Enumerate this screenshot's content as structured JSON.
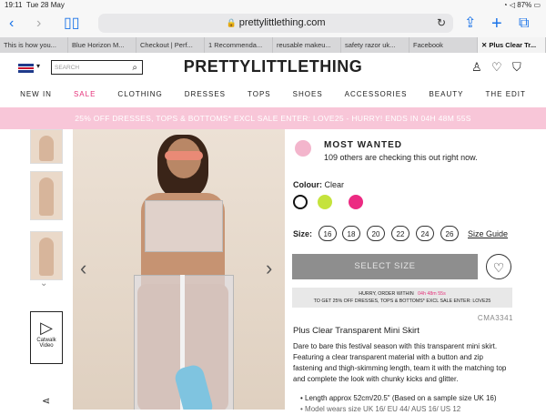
{
  "status": {
    "time": "19:11",
    "date": "Tue 28 May",
    "battery": "87%"
  },
  "browser": {
    "url": "prettylittlething.com",
    "tabs": [
      "This is how you...",
      "Blue Horizon M...",
      "Checkout | Perf...",
      "1 Recommenda...",
      "reusable makeu...",
      "safety razor uk...",
      "Facebook",
      "Plus Clear Tr..."
    ]
  },
  "header": {
    "logo": "PRETTYLITTLETHING",
    "search_placeholder": "SEARCH"
  },
  "nav": [
    "NEW IN",
    "SALE",
    "CLOTHING",
    "DRESSES",
    "TOPS",
    "SHOES",
    "ACCESSORIES",
    "BEAUTY",
    "THE EDIT"
  ],
  "promo": "25% OFF DRESSES, TOPS & BOTTOMS* EXCL SALE ENTER: LOVE25 - HURRY! ENDS IN 04H 48M 55S",
  "gallery": {
    "catwalk_label": "Catwalk Video"
  },
  "product": {
    "most_wanted_title": "MOST WANTED",
    "most_wanted_sub": "109 others are checking this out right now.",
    "colour_label": "Colour:",
    "colour_value": "Clear",
    "colours": [
      "#ffffff",
      "#c5e33c",
      "#ec2a82"
    ],
    "size_label": "Size:",
    "sizes": [
      "16",
      "18",
      "20",
      "22",
      "24",
      "26"
    ],
    "size_guide": "Size Guide",
    "select_size": "SELECT SIZE",
    "hurry_line1": "HURRY, ORDER WITHIN",
    "hurry_timer": "04h 48m 55s",
    "hurry_line2": "TO GET 25% OFF DRESSES, TOPS & BOTTOMS* EXCL SALE ENTER: LOVE25",
    "code": "CMA3341",
    "name": "Plus Clear Transparent Mini Skirt",
    "description": "Dare to bare this festival season with this transparent mini skirt. Featuring a clear transparent material with a button and zip fastening and thigh-skimming length, team it with the matching top and complete the look with chunky kicks and glitter.",
    "bullet1": "Length approx 52cm/20.5\" (Based on a sample size UK 16)",
    "bullet2": "Model wears size UK 16/ EU 44/ AUS 16/ US 12"
  },
  "colors": {
    "accent": "#e5327a",
    "promo_bg": "#f8c6d8"
  }
}
